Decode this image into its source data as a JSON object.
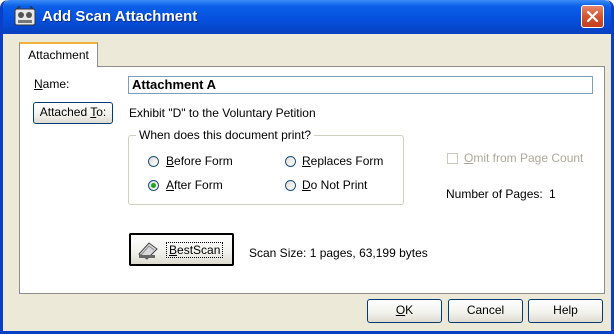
{
  "window": {
    "title": "Add Scan Attachment",
    "icon": "scanner-app-icon"
  },
  "tabs": [
    {
      "label": "Attachment",
      "active": true
    }
  ],
  "form": {
    "name_label_first": "N",
    "name_label_rest": "ame:",
    "name_value": "Attachment A",
    "attached_to_button_prefix": "Attached ",
    "attached_to_button_key": "T",
    "attached_to_button_suffix": "o:",
    "attached_to_value": "Exhibit \"D\" to the Voluntary Petition"
  },
  "print_group": {
    "title": "When does this document print?",
    "options": [
      {
        "key": "B",
        "rest": "efore Form",
        "checked": false
      },
      {
        "key": "A",
        "rest": "fter Form",
        "checked": true
      },
      {
        "key": "R",
        "rest": "eplaces Form",
        "checked": false
      },
      {
        "key": "D",
        "rest": "o Not Print",
        "checked": false
      }
    ]
  },
  "omit": {
    "key": "O",
    "rest": "mit from Page Count",
    "checked": false,
    "enabled": false
  },
  "pages": {
    "label": "Number of Pages:",
    "value": "1"
  },
  "scan": {
    "button_key": "B",
    "button_rest": "estScan",
    "icon": "scanner-icon",
    "size_text": "Scan Size: 1 pages, 63,199 bytes"
  },
  "footer": {
    "ok_key": "O",
    "ok_rest": "K",
    "cancel_label": "Cancel",
    "help_label": "Help"
  },
  "colors": {
    "titlebar": "#0651df",
    "dialog_face": "#ece9d8",
    "close_button": "#d5532f",
    "tab_highlight": "#f0b33a",
    "radio_dot": "#21a121"
  }
}
